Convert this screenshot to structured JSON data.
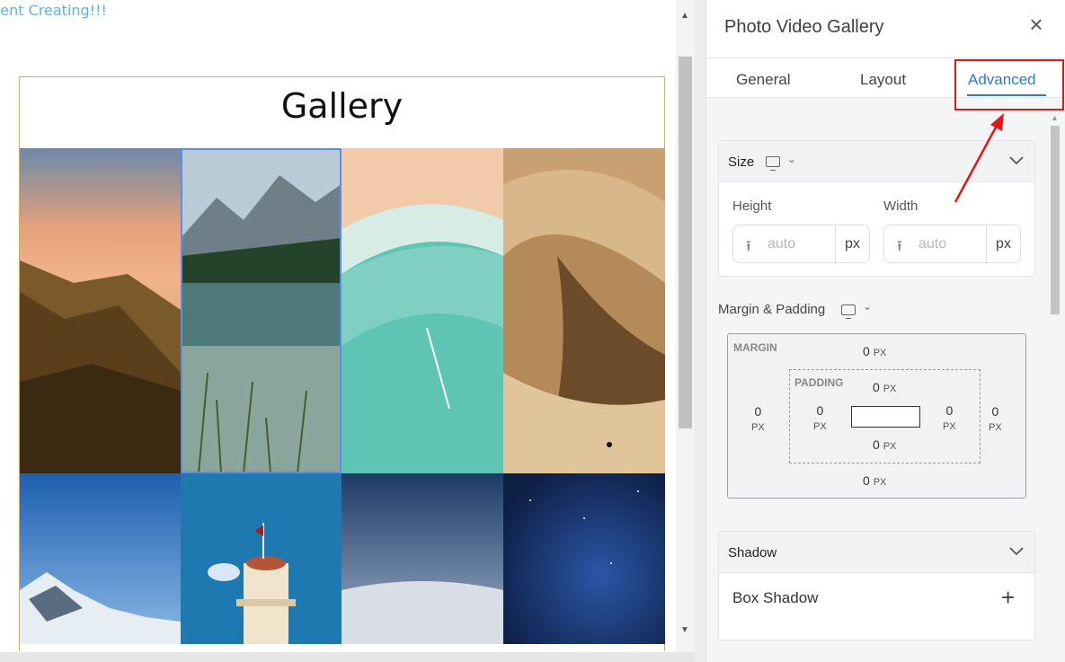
{
  "canvas": {
    "header_text": "tent Creating!!!",
    "gallery_title": "Gallery"
  },
  "panel": {
    "title": "Photo Video Gallery",
    "tabs": [
      "General",
      "Layout",
      "Advanced"
    ],
    "active_tab": "Advanced",
    "size": {
      "label": "Size",
      "height_label": "Height",
      "width_label": "Width",
      "height_placeholder": "auto",
      "width_placeholder": "auto",
      "unit": "px"
    },
    "margin_padding": {
      "label": "Margin & Padding",
      "margin_caption": "MARGIN",
      "padding_caption": "PADDING",
      "values": {
        "num": "0",
        "unit": "PX"
      }
    },
    "shadow": {
      "label": "Shadow",
      "box_shadow_label": "Box Shadow",
      "add_symbol": "+"
    }
  },
  "colors": {
    "accent": "#2b7bd6",
    "highlight": "#e01818",
    "gallery_border": "#f0a830",
    "selected_tile": "#5b8def"
  }
}
